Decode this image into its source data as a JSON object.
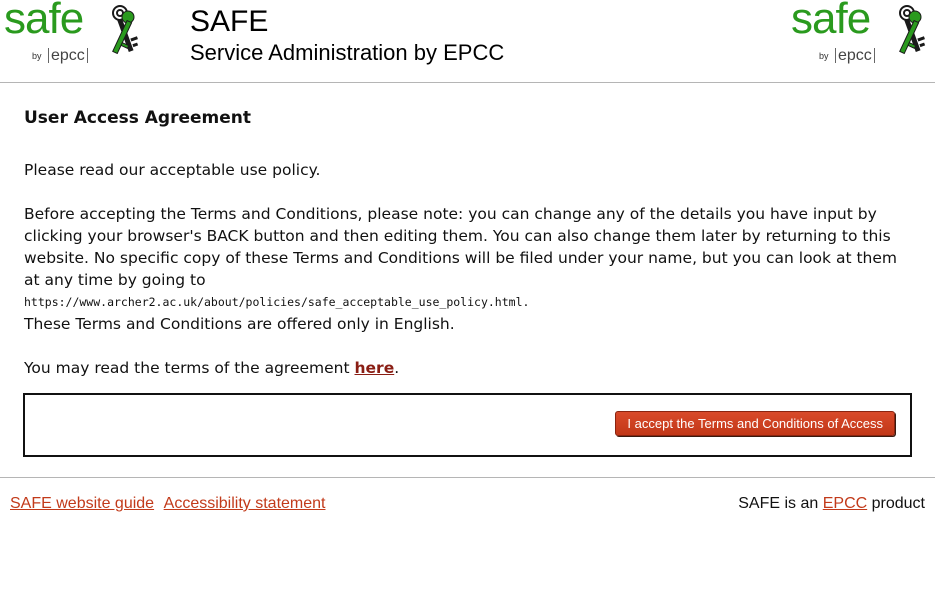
{
  "header": {
    "logo_word": "safe",
    "logo_by": "by",
    "logo_org": "epcc",
    "title": "SAFE",
    "subtitle": "Service Administration by EPCC",
    "brand_color": "#2a9a1e"
  },
  "main": {
    "heading": "User Access Agreement",
    "intro": "Please read our acceptable use policy.",
    "terms_note": "Before accepting the Terms and Conditions, please note: you can change any of the details you have input by clicking your browser's BACK button and then editing them. You can also change them later by returning to this website. No specific copy of these Terms and Conditions will be filed under your name, but you can look at them at any time by going to",
    "policy_url": "https://www.archer2.ac.uk/about/policies/safe_acceptable_use_policy.html.",
    "language_note": "These Terms and Conditions are offered only in English.",
    "read_terms_prefix": "You may read the terms of the agreement ",
    "read_terms_link": "here",
    "read_terms_suffix": ".",
    "accept_button_label": "I accept the Terms and Conditions of Access",
    "accent_color": "#c23718"
  },
  "footer": {
    "links": [
      "SAFE website guide",
      "Accessibility statement"
    ],
    "product_prefix": "SAFE is an ",
    "product_link": "EPCC",
    "product_suffix": " product"
  }
}
